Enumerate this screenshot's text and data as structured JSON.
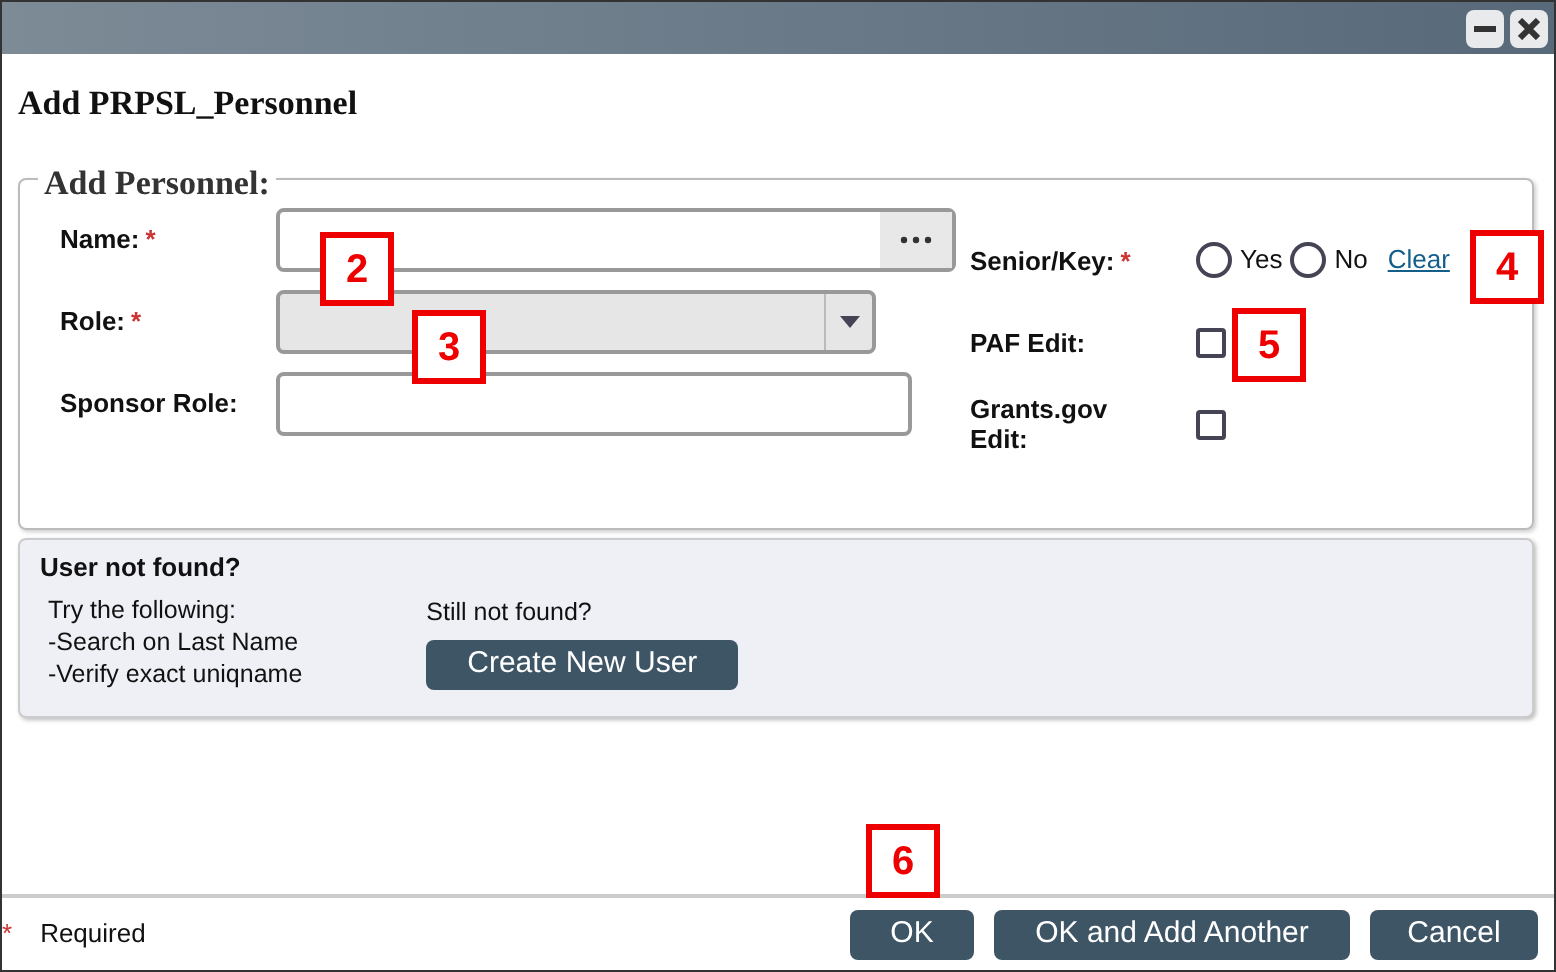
{
  "window": {
    "title_bar_buttons": [
      {
        "kind": "minimize"
      },
      {
        "kind": "close"
      }
    ]
  },
  "heading": "Add PRPSL_Personnel",
  "fieldset": {
    "legend": "Add Personnel:",
    "left_fields": [
      {
        "label": "Name:",
        "mark": "*",
        "kind": "lookup",
        "disabled": false
      },
      {
        "label": "Role:",
        "mark": "*",
        "kind": "select",
        "disabled": true
      },
      {
        "label": "Sponsor Role:",
        "kind": "text",
        "disabled": false
      }
    ],
    "senior_key": {
      "label": "Senior/Key:",
      "mark": "*",
      "options": [
        {
          "label": "Yes",
          "selected": false
        },
        {
          "label": "No",
          "selected": false
        }
      ],
      "clear_link": "Clear"
    },
    "checkboxes": [
      {
        "label": "PAF Edit:",
        "checked": false
      },
      {
        "label": "Grants.gov Edit:",
        "checked": false
      }
    ]
  },
  "help_panel": {
    "title": "User not found?",
    "tips": [
      "Try the following:",
      "-Search on Last Name",
      "-Verify exact uniqname"
    ],
    "still_text": "Still not found?",
    "button": "Create New User"
  },
  "footer": {
    "mark": "*",
    "legend": "Required",
    "buttons": [
      "OK",
      "OK and Add Another",
      "Cancel"
    ]
  },
  "callouts": [
    "2",
    "3",
    "4",
    "5",
    "6"
  ]
}
